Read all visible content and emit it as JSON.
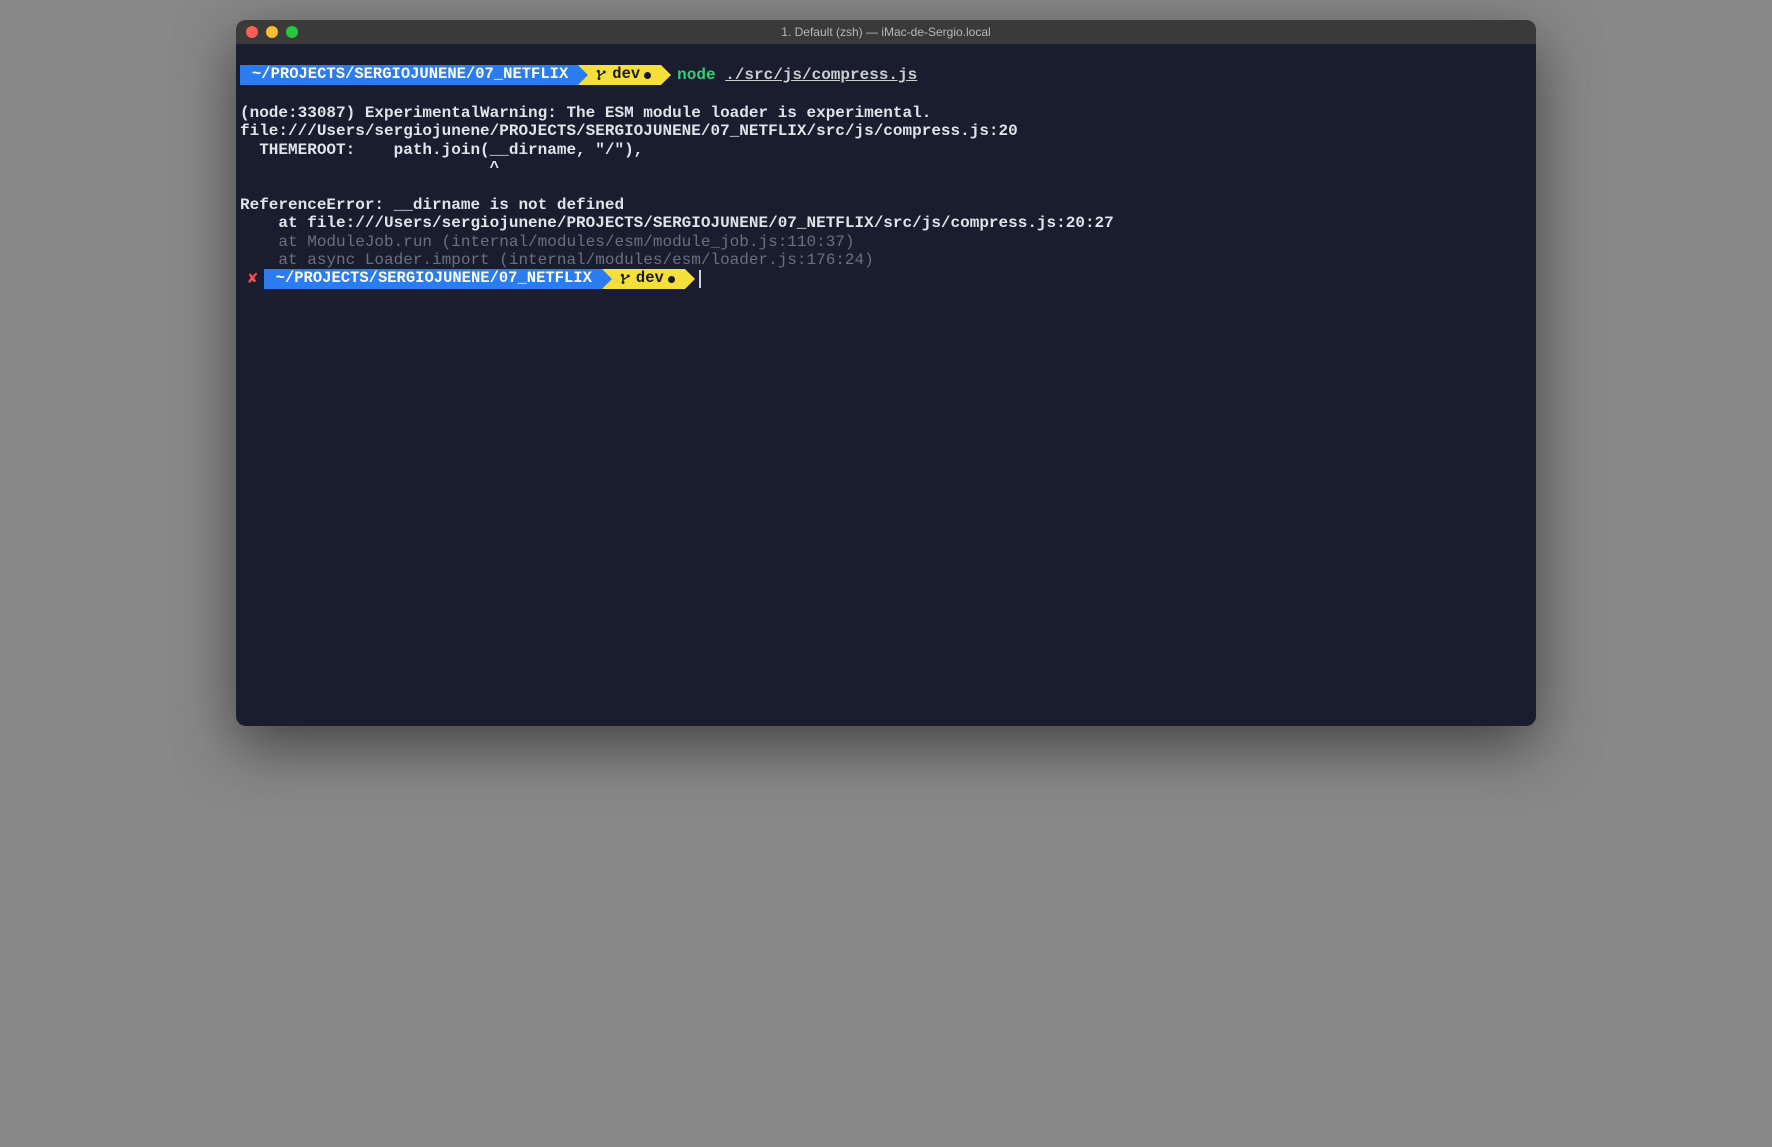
{
  "titlebar": {
    "title": "1. Default (zsh) — iMac-de-Sergio.local"
  },
  "prompt1": {
    "path": "~/PROJECTS/SERGIOJUNENE/07_NETFLIX",
    "branch": "dev",
    "command_bin": "node",
    "command_arg": "./src/js/compress.js"
  },
  "output": {
    "line1": "(node:33087) ExperimentalWarning: The ESM module loader is experimental.",
    "line2": "file:///Users/sergiojunene/PROJECTS/SERGIOJUNENE/07_NETFLIX/src/js/compress.js:20",
    "line3": "  THEMEROOT:    path.join(__dirname, \"/\"),",
    "line4": "                          ^",
    "blank": "",
    "line5": "ReferenceError: __dirname is not defined",
    "line6": "    at file:///Users/sergiojunene/PROJECTS/SERGIOJUNENE/07_NETFLIX/src/js/compress.js:20:27",
    "line7": "    at ModuleJob.run (internal/modules/esm/module_job.js:110:37)",
    "line8": "    at async Loader.import (internal/modules/esm/loader.js:176:24)"
  },
  "prompt2": {
    "status": "✘",
    "path": "~/PROJECTS/SERGIOJUNENE/07_NETFLIX",
    "branch": "dev"
  }
}
